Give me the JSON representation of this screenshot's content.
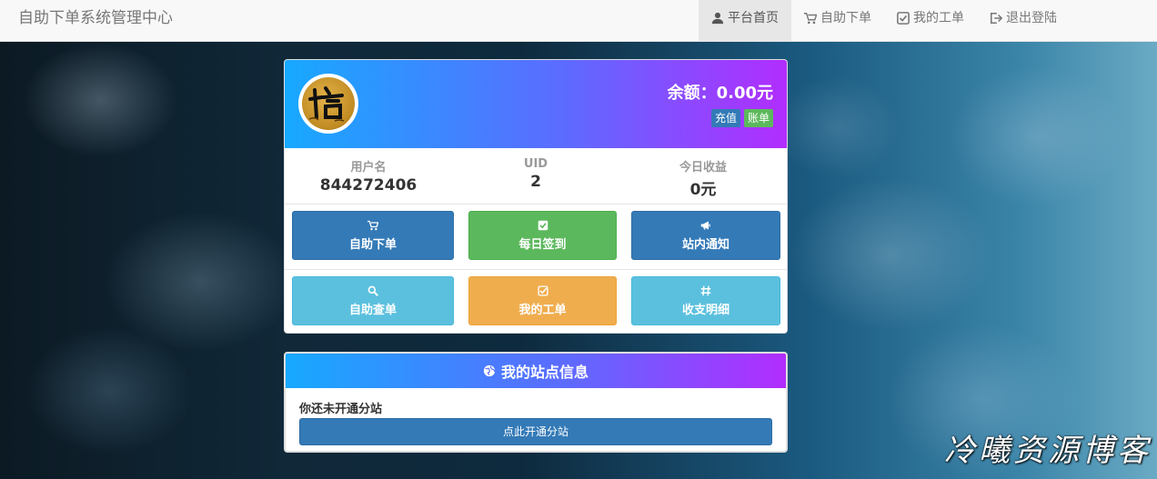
{
  "navbar": {
    "brand": "自助下单系统管理中心",
    "items": [
      {
        "label": "平台首页",
        "icon": "user-icon",
        "active": true
      },
      {
        "label": "自助下单",
        "icon": "cart-icon",
        "active": false
      },
      {
        "label": "我的工单",
        "icon": "check-square-icon",
        "active": false
      },
      {
        "label": "退出登陆",
        "icon": "logout-icon",
        "active": false
      }
    ]
  },
  "profile": {
    "balance": "余额：0.00元",
    "recharge_label": "充值",
    "bill_label": "账单",
    "stats": [
      {
        "label": "用户名",
        "value": "844272406"
      },
      {
        "label": "UID",
        "value": "2"
      },
      {
        "label": "今日收益",
        "value": "0元"
      }
    ]
  },
  "actions": [
    {
      "label": "自助下单",
      "icon": "cart-icon",
      "color": "#337ab7"
    },
    {
      "label": "每日签到",
      "icon": "check-square-icon",
      "color": "#5cb85c"
    },
    {
      "label": "站内通知",
      "icon": "bullhorn-icon",
      "color": "#337ab7"
    },
    {
      "label": "自助查单",
      "icon": "search-icon",
      "color": "#5bc0de"
    },
    {
      "label": "我的工单",
      "icon": "check-square-outline-icon",
      "color": "#f0ad4e"
    },
    {
      "label": "收支明细",
      "icon": "hash-icon",
      "color": "#5bc0de"
    }
  ],
  "site_panel": {
    "title": "我的站点信息",
    "message": "你还未开通分站",
    "button_label": "点此开通分站"
  },
  "watermark": "冷曦资源博客",
  "colors": {
    "gradient_start": "#17a9ff",
    "gradient_end": "#b22dff",
    "primary": "#337ab7",
    "success": "#5cb85c",
    "info": "#5bc0de",
    "warning": "#f0ad4e"
  }
}
